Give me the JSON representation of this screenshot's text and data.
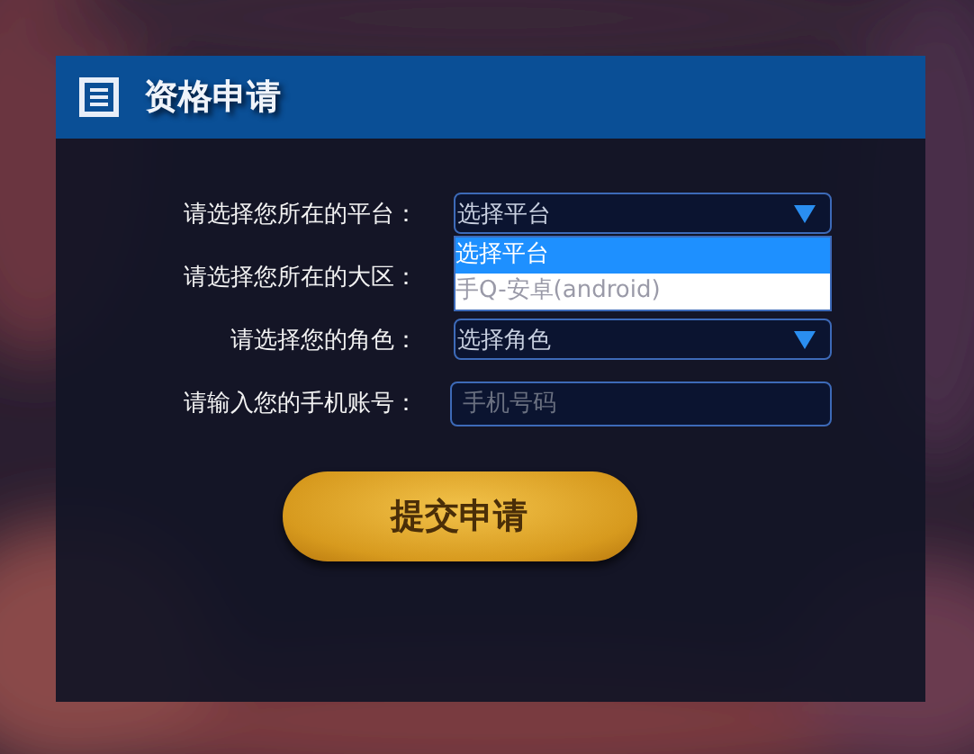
{
  "panel": {
    "title": "资格申请"
  },
  "fields": [
    {
      "kind": "select",
      "label": "请选择您所在的平台：",
      "value": "选择平台",
      "dropdown": {
        "options": [
          {
            "label": "选择平台",
            "selected": true
          },
          {
            "label": "手Q-安卓(android)",
            "selected": false
          }
        ]
      }
    },
    {
      "kind": "hidden",
      "label": "请选择您所在的大区："
    },
    {
      "kind": "select",
      "label": "请选择您的角色：",
      "value": "选择角色"
    },
    {
      "kind": "input",
      "label": "请输入您的手机账号：",
      "placeholder": "手机号码"
    }
  ],
  "submit": {
    "label": "提交申请"
  }
}
